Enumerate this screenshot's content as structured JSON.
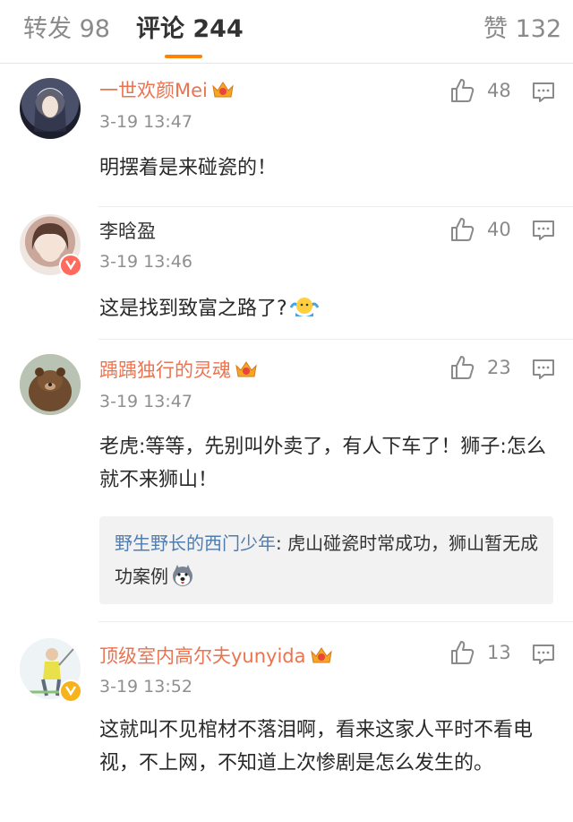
{
  "tabs": {
    "repost": "转发 98",
    "comments": "评论 244",
    "likes": "赞 132"
  },
  "comments": [
    {
      "username": "一世欢颜Mei",
      "time": "3-19 13:47",
      "likes": "48",
      "text": "明摆着是来碰瓷的！"
    },
    {
      "username": "李晗盈",
      "time": "3-19 13:46",
      "likes": "40",
      "text": "这是找到致富之路了?"
    },
    {
      "username": "踽踽独行的灵魂",
      "time": "3-19 13:47",
      "likes": "23",
      "text": "老虎:等等，先别叫外卖了，有人下车了！狮子:怎么就不来狮山！",
      "quote": {
        "user": "野生野长的西门少年",
        "text": ": 虎山碰瓷时常成功，狮山暂无成功案例"
      }
    },
    {
      "username": "顶级室内高尔夫yunyida",
      "time": "3-19 13:52",
      "likes": "13",
      "text": "这就叫不见棺材不落泪啊，看来这家人平时不看电视，不上网，不知道上次惨剧是怎么发生的。"
    }
  ],
  "colors": {
    "accent": "#ff8200",
    "vip_name": "#eb7350",
    "quote_user": "#507daf",
    "muted": "#8f8f8f"
  },
  "icons": [
    "thumbs-up-icon",
    "reply-icon",
    "vip-crown-icon",
    "emoji-shrug-icon",
    "emoji-husky-icon",
    "verified-badge-icon"
  ]
}
